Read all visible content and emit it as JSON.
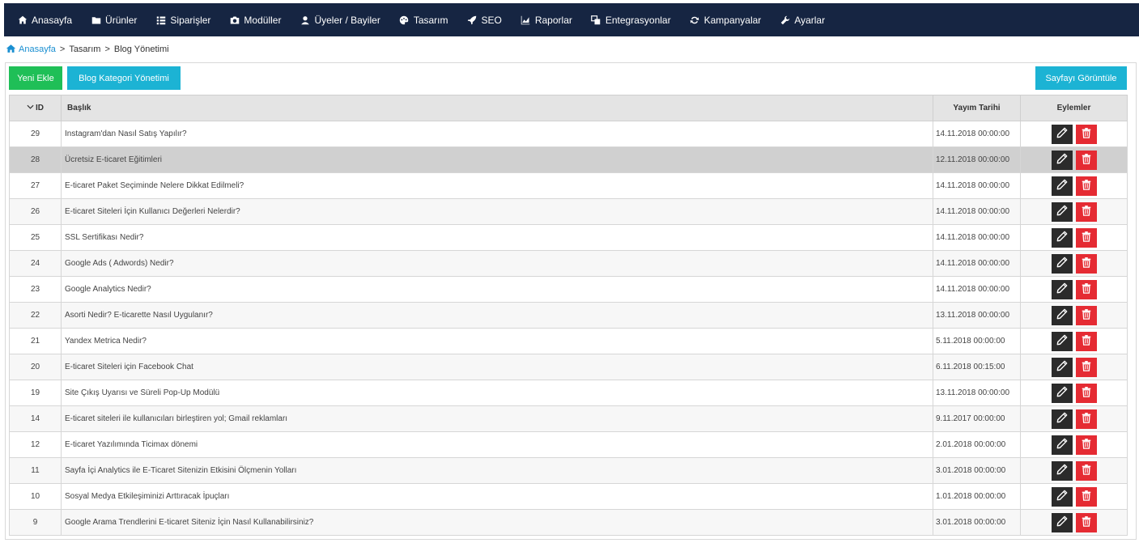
{
  "nav": [
    {
      "label": "Anasayfa",
      "icon": "home-icon"
    },
    {
      "label": "Ürünler",
      "icon": "folder-icon"
    },
    {
      "label": "Siparişler",
      "icon": "list-icon"
    },
    {
      "label": "Modüller",
      "icon": "camera-icon"
    },
    {
      "label": "Üyeler / Bayiler",
      "icon": "user-icon"
    },
    {
      "label": "Tasarım",
      "icon": "palette-icon"
    },
    {
      "label": "SEO",
      "icon": "rocket-icon"
    },
    {
      "label": "Raporlar",
      "icon": "chart-icon"
    },
    {
      "label": "Entegrasyonlar",
      "icon": "windows-icon"
    },
    {
      "label": "Kampanyalar",
      "icon": "refresh-icon"
    },
    {
      "label": "Ayarlar",
      "icon": "wrench-icon"
    }
  ],
  "breadcrumb": {
    "home": "Anasayfa",
    "items": [
      "Tasarım",
      "Blog Yönetimi"
    ],
    "separator": ">"
  },
  "toolbar": {
    "new_label": "Yeni Ekle",
    "category_label": "Blog Kategori Yönetimi",
    "view_label": "Sayfayı Görüntüle"
  },
  "table": {
    "headers": {
      "id": "ID",
      "title": "Başlık",
      "date": "Yayım Tarihi",
      "actions": "Eylemler"
    },
    "rows": [
      {
        "id": "29",
        "title": "Instagram'dan Nasıl Satış Yapılır?",
        "date": "14.11.2018 00:00:00"
      },
      {
        "id": "28",
        "title": "Ücretsiz E-ticaret Eğitimleri",
        "date": "12.11.2018 00:00:00"
      },
      {
        "id": "27",
        "title": "E-ticaret Paket Seçiminde Nelere Dikkat Edilmeli?",
        "date": "14.11.2018 00:00:00"
      },
      {
        "id": "26",
        "title": "E-ticaret Siteleri İçin Kullanıcı Değerleri Nelerdir?",
        "date": "14.11.2018 00:00:00"
      },
      {
        "id": "25",
        "title": "SSL Sertifikası Nedir?",
        "date": "14.11.2018 00:00:00"
      },
      {
        "id": "24",
        "title": "Google Ads ( Adwords) Nedir?",
        "date": "14.11.2018 00:00:00"
      },
      {
        "id": "23",
        "title": "Google Analytics Nedir?",
        "date": "14.11.2018 00:00:00"
      },
      {
        "id": "22",
        "title": "Asorti Nedir? E-ticarette Nasıl Uygulanır?",
        "date": "13.11.2018 00:00:00"
      },
      {
        "id": "21",
        "title": "Yandex Metrica Nedir?",
        "date": "5.11.2018 00:00:00"
      },
      {
        "id": "20",
        "title": "E-ticaret Siteleri için Facebook Chat",
        "date": "6.11.2018 00:15:00"
      },
      {
        "id": "19",
        "title": "Site Çıkış Uyarısı ve Süreli Pop-Up Modülü",
        "date": "13.11.2018 00:00:00"
      },
      {
        "id": "14",
        "title": "E-ticaret siteleri ile kullanıcıları birleştiren yol; Gmail reklamları",
        "date": "9.11.2017 00:00:00"
      },
      {
        "id": "12",
        "title": "E-ticaret Yazılımında Ticimax dönemi",
        "date": "2.01.2018 00:00:00"
      },
      {
        "id": "11",
        "title": "Sayfa İçi Analytics ile E-Ticaret Sitenizin Etkisini Ölçmenin Yolları",
        "date": "3.01.2018 00:00:00"
      },
      {
        "id": "10",
        "title": "Sosyal Medya Etkileşiminizi Arttıracak İpuçları",
        "date": "1.01.2018 00:00:00"
      },
      {
        "id": "9",
        "title": "Google Arama Trendlerini E-ticaret Siteniz İçin Nasıl Kullanabilirsiniz?",
        "date": "3.01.2018 00:00:00"
      }
    ],
    "highlighted_row_id": "28"
  },
  "colors": {
    "nav_bg": "#162542",
    "link": "#1a8fd1",
    "btn_green": "#1fbf57",
    "btn_cyan": "#1cb3d4",
    "edit_btn": "#2b2b2b",
    "delete_btn": "#e52b33",
    "row_highlight": "#d0d0d0"
  }
}
